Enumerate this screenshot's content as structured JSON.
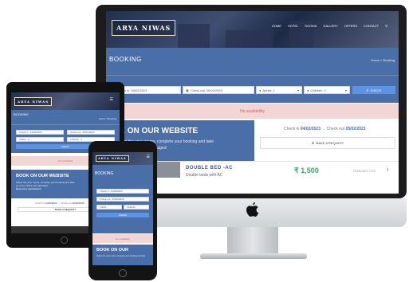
{
  "site": {
    "logo": "ARYA NIWAS",
    "nav": [
      "HOME",
      "HOTEL",
      "ROOMS",
      "GALLERY",
      "OFFERS",
      "CONTACT"
    ],
    "page_title": "BOOKING",
    "page_title_tablet": "BOOKING",
    "breadcrumb": "Home > Booking",
    "form": {
      "checkin_label": "Check in",
      "checkin_value": "04/02/2023",
      "checkout_label": "Check out",
      "checkout_value": "05/02/2023",
      "adults_label": "Adults",
      "adults_value": "1",
      "children_label": "Children",
      "children_value": "0",
      "check_button": "CHECK"
    },
    "no_availability": "No availability",
    "book_heading": "BOOK ON OUR WEBSITE",
    "book_heading_partial": "OK ON OUR WEBSITE",
    "book_heading_phone": "BOOK ON OUR",
    "book_sub_line1": "Select the your rooms, complete your booking and take",
    "book_sub_line1_partial": "ll Select the your rooms, complete your booking and take",
    "book_sub_line2": "ge of our offers and packages!",
    "book_sub_line3": "Best price guaranteed",
    "checkin_summary": "Check in",
    "checkin_date": "04/02/2023",
    "checkout_summary": "Check out",
    "checkout_date": "05/02/2023",
    "make_request": "MAKE A REQUEST",
    "room": {
      "name": "DOUBLE BED -AC",
      "desc": "Double beds with AC",
      "price": "₹ 1,500",
      "period": "FEBRUARY 2023"
    }
  },
  "colors": {
    "band": "#4a6ea8",
    "button": "#5d93e3",
    "alert_bg": "#f2d6d6",
    "alert_text": "#cc6767",
    "price": "#3aa76d"
  },
  "icons": [
    "calendar-icon",
    "user-icon",
    "search-icon",
    "arrow-right-icon",
    "chevron-right-icon",
    "apple-logo-icon",
    "search-nav-icon",
    "menu-icon"
  ]
}
